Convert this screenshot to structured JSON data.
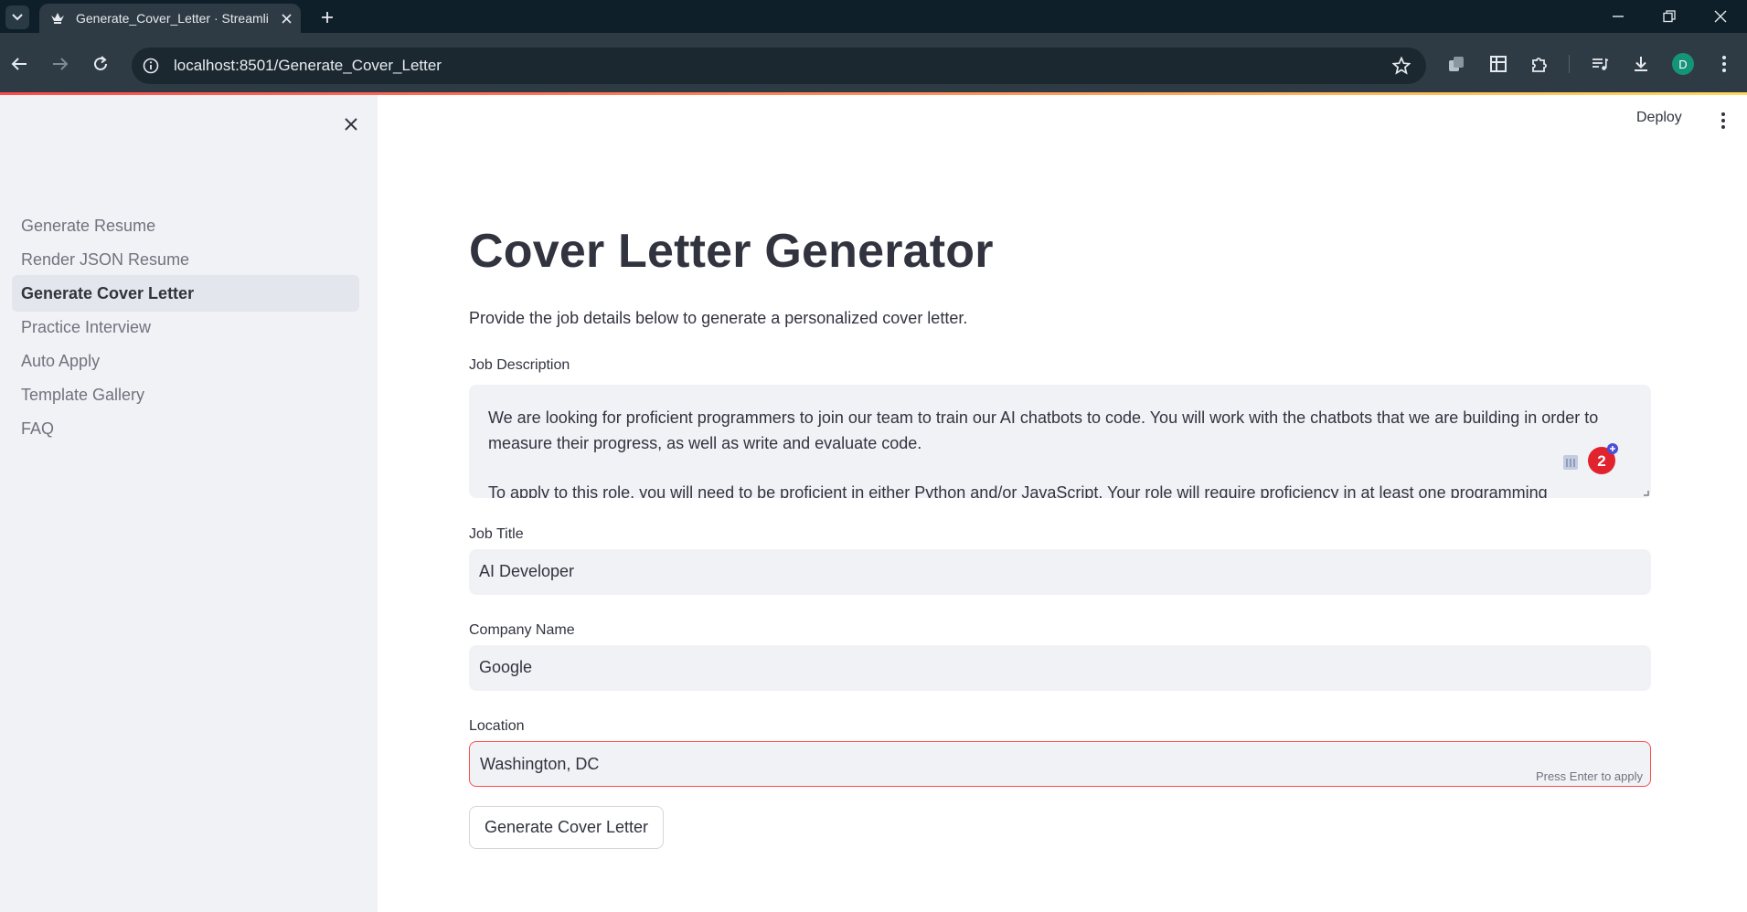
{
  "browser": {
    "tab_title": "Generate_Cover_Letter · Streamlit",
    "url": "localhost:8501/Generate_Cover_Letter",
    "profile_initial": "D"
  },
  "colors": {
    "accent": "#ff4b4b",
    "text": "#31333f",
    "muted": "#70737d",
    "sidebar_bg": "#f0f2f6",
    "chrome_bg": "#2e3b45",
    "profile_bg": "#149478"
  },
  "sidebar": {
    "items": [
      {
        "label": "Generate Resume"
      },
      {
        "label": "Render JSON Resume"
      },
      {
        "label": "Generate Cover Letter",
        "active": true
      },
      {
        "label": "Practice Interview"
      },
      {
        "label": "Auto Apply"
      },
      {
        "label": "Template Gallery"
      },
      {
        "label": "FAQ"
      }
    ]
  },
  "header": {
    "deploy_label": "Deploy"
  },
  "main": {
    "title": "Cover Letter Generator",
    "subtitle": "Provide the job details below to generate a personalized cover letter.",
    "job_description": {
      "label": "Job Description",
      "paragraph1": "We are looking for proficient programmers to join our team to train our AI chatbots to code. You will work with the chatbots that we are building in order to measure their progress, as well as write and evaluate code.",
      "paragraph2": "To apply to this role, you will need to be proficient in either Python and/or JavaScript. Your role will require proficiency in at least one programming"
    },
    "job_title": {
      "label": "Job Title",
      "value": "AI Developer"
    },
    "company_name": {
      "label": "Company Name",
      "value": "Google"
    },
    "location": {
      "label": "Location",
      "value": "Washington, DC",
      "hint": "Press Enter to apply"
    },
    "generate_button_label": "Generate Cover Letter",
    "extension_badge": "2"
  }
}
